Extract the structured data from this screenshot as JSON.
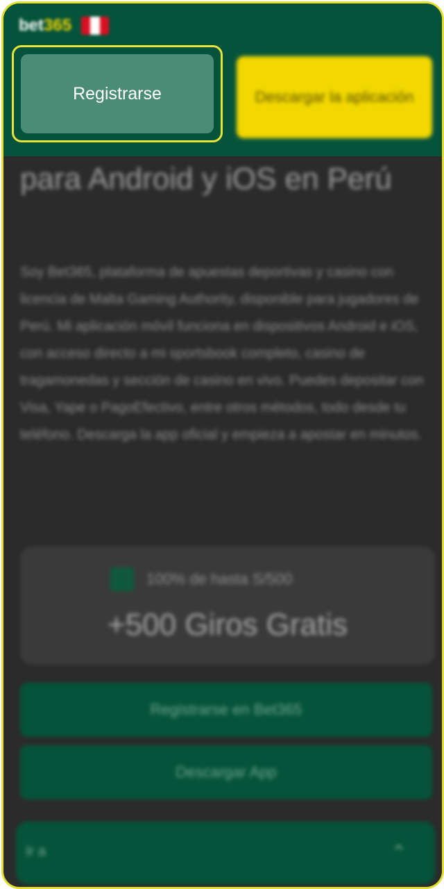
{
  "header": {
    "logo_bet": "bet",
    "logo_num": "365",
    "register_label": "Registrarse",
    "download_label": "Descargar la aplicación"
  },
  "main": {
    "title": "para Android y iOS en Perú",
    "paragraph": "Soy Bet365, plataforma de apuestas deportivas y casino con licencia de Malta Gaming Authority, disponible para jugadores de Perú. Mi aplicación móvil funciona en dispositivos Android e iOS, con acceso directo a mi sportsbook completo, casino de tragamonedas y sección de casino en vivo. Puedes depositar con Visa, Yape o PagoEfectivo, entre otros métodos, todo desde tu teléfono. Descarga la app oficial y empieza a apostar en minutos."
  },
  "bonus": {
    "line1": "100% de hasta S/500",
    "line2": "+500 Giros Gratis"
  },
  "cta": {
    "register": "Registrarse en Bet365",
    "download": "Descargar App"
  },
  "faq": {
    "label": "Ir a",
    "icon": "chevron-up-icon"
  },
  "colors": {
    "header_bg": "#05533a",
    "accent_yellow": "#f2d800",
    "highlight_border": "#e2df2e",
    "page_bg": "#2b2b2b"
  }
}
